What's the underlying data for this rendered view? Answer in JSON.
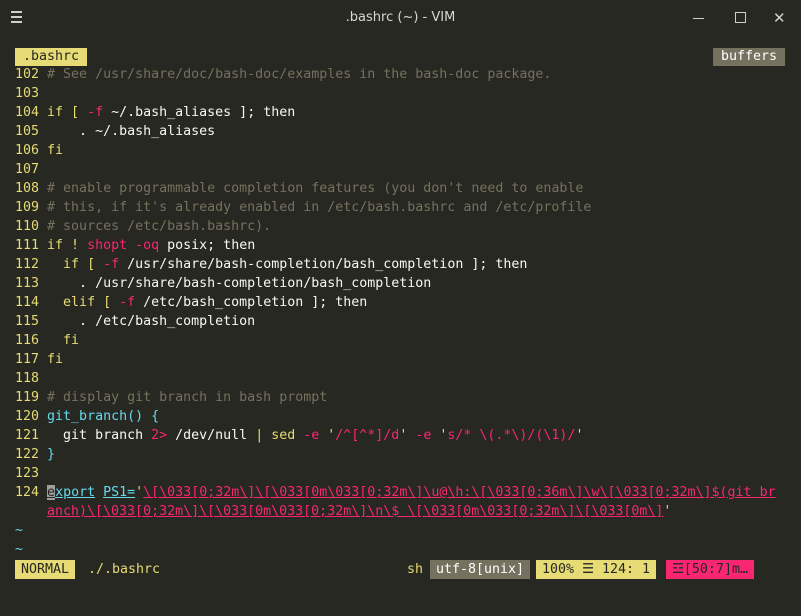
{
  "titlebar": {
    "title": ".bashrc (~) - VIM",
    "minimize_icon": "minimize-icon",
    "maximize_icon": "maximize-icon",
    "close_icon": "close-icon"
  },
  "tabline": {
    "active_tab": ".bashrc",
    "buffers_label": "buffers"
  },
  "lines": {
    "l102": {
      "num": "102",
      "c": " # See /usr/share/doc/bash-doc/examples in the bash-doc package."
    },
    "l103": {
      "num": "103"
    },
    "l104": {
      "num": "104",
      "a": " if [ ",
      "b": "-f",
      "c": " ~/.bash_aliases ]; then"
    },
    "l105": {
      "num": "105",
      "a": "     . ~/.bash_aliases"
    },
    "l106": {
      "num": "106",
      "a": " fi"
    },
    "l107": {
      "num": "107"
    },
    "l108": {
      "num": "108",
      "c": " # enable programmable completion features (you don't need to enable"
    },
    "l109": {
      "num": "109",
      "c": " # this, if it's already enabled in /etc/bash.bashrc and /etc/profile"
    },
    "l110": {
      "num": "110",
      "c": " # sources /etc/bash.bashrc)."
    },
    "l111": {
      "num": "111",
      "a": " if ! ",
      "b": "shopt -oq",
      "c": " posix; then"
    },
    "l112": {
      "num": "112",
      "a": "   if [ ",
      "b": "-f",
      "c": " /usr/share/bash-completion/bash_completion ]; then"
    },
    "l113": {
      "num": "113",
      "a": "     . /usr/share/bash-completion/bash_completion"
    },
    "l114": {
      "num": "114",
      "a": "   elif [ ",
      "b": "-f",
      "c": " /etc/bash_completion ]; then"
    },
    "l115": {
      "num": "115",
      "a": "     . /etc/bash_completion"
    },
    "l116": {
      "num": "116",
      "a": "   fi"
    },
    "l117": {
      "num": "117",
      "a": " fi"
    },
    "l118": {
      "num": "118"
    },
    "l119": {
      "num": "119",
      "c": " # display git branch in bash prompt"
    },
    "l120": {
      "num": "120",
      "a": " git_branch() {"
    },
    "l121": {
      "num": "121",
      "a": "   git branch ",
      "b": "2>",
      "c": " /dev/null ",
      "d": "|",
      "e": " sed ",
      "f": "-e",
      "g": " '",
      "h": "/^[^*]/d",
      "i": "' ",
      "j": "-e",
      "k": " '",
      "l": "s/* \\(.*\\)/(\\1)/",
      "m": "'"
    },
    "l122": {
      "num": "122",
      "a": " }"
    },
    "l123": {
      "num": "123"
    },
    "l124": {
      "num": "124",
      "cursor": "e",
      "a": "xport",
      "b": " ",
      "c": "PS1=",
      "d": "'",
      "e": "\\[\\033[0;32m\\]\\[\\033[0m\\033[0;32m\\]\\u@\\h:\\[\\033[0;36m\\]\\w\\[\\033[0;32m\\]$(git br"
    },
    "l124w": {
      "a": "anch)\\[\\033[0;32m\\]\\[\\033[0m\\033[0;32m\\]\\n\\$ \\[\\033[0m\\033[0;32m\\]\\[\\033[0m\\]",
      "b": "'"
    },
    "tilde": "~"
  },
  "statusline": {
    "mode": "NORMAL",
    "filename": "./.bashrc",
    "filetype": "sh",
    "encoding": "utf-8[unix]",
    "position": "100% ☰  124:  1",
    "warning": "☲[50:7]m…"
  },
  "colors": {
    "background": "#272822",
    "accent_yellow": "#e6db74",
    "accent_red": "#f92672",
    "accent_cyan": "#66d9ef",
    "comment": "#75715e"
  }
}
